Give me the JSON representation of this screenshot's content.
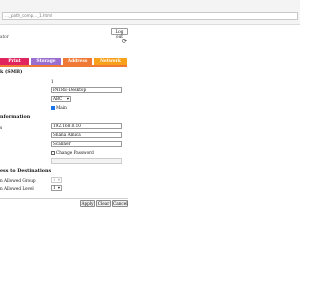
{
  "browser": {
    "url": "…_path_comp…_1.html"
  },
  "header": {
    "title": "ator",
    "logout_label": "Log out",
    "refresh_icon": "refresh-icon"
  },
  "tabs": [
    {
      "label": "Print",
      "color": "#e0245e"
    },
    {
      "label": "Storage",
      "color": "#9b6fcf"
    },
    {
      "label": "Address",
      "color": "#f07a35"
    },
    {
      "label": "Network",
      "color": "#f7a11a"
    }
  ],
  "smb": {
    "heading": "k (SMB)",
    "number_value": "1",
    "name_value": "PATRE-Desktop",
    "type_value": "ABC",
    "main_label": "Main",
    "main_checked": true
  },
  "information": {
    "heading": "nformation",
    "row_label": "s",
    "ip_value": "192.168.0.10",
    "user_value": "Shana Amica",
    "password_value": "Scanner",
    "change_password_label": "Change Password",
    "extra_value": ""
  },
  "destinations": {
    "heading": "ess to Destinations",
    "group_label": "n Allowed Group",
    "group_value": "1",
    "level_label": "n Allowed Level",
    "level_value": "1"
  },
  "actions": {
    "apply": "Apply",
    "clear": "Clear",
    "cancel": "Cancel"
  }
}
